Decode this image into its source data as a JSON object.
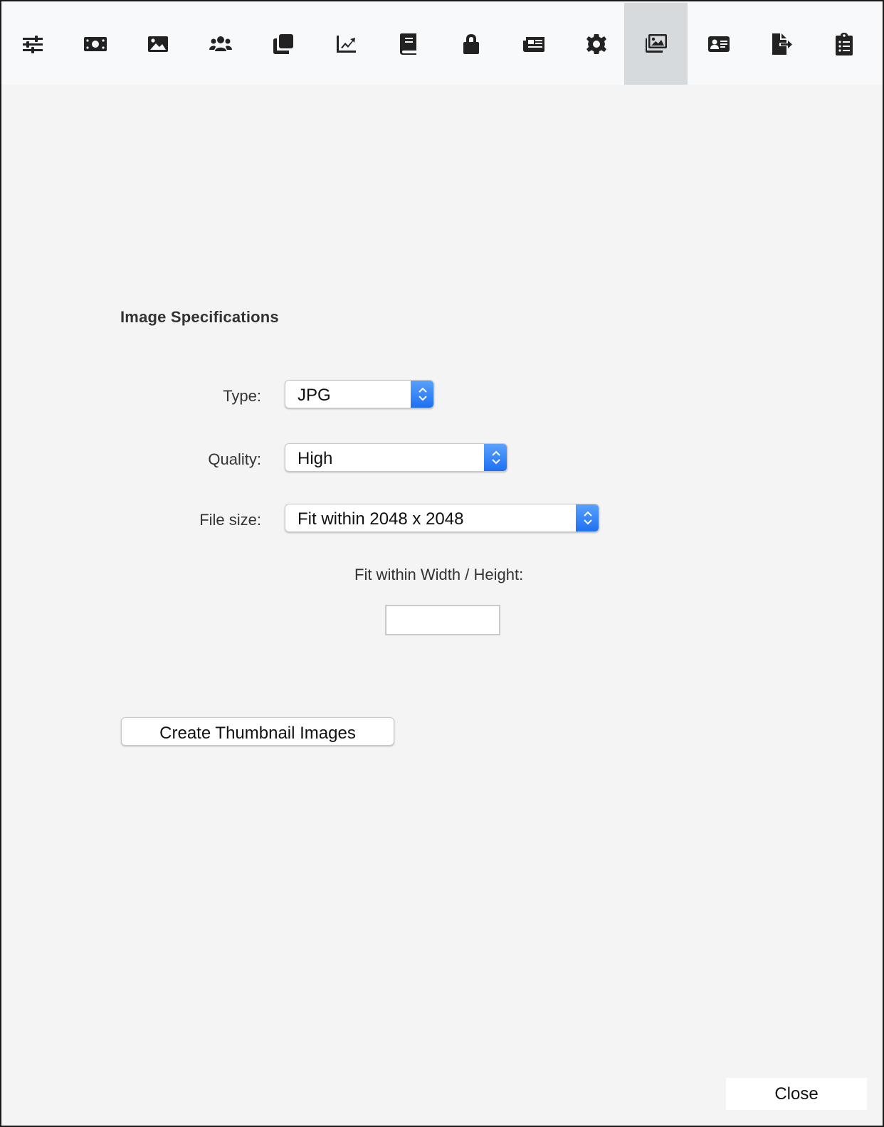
{
  "toolbar": {
    "tabs": [
      {
        "icon": "sliders-icon"
      },
      {
        "icon": "money-icon"
      },
      {
        "icon": "image-icon"
      },
      {
        "icon": "users-icon"
      },
      {
        "icon": "clone-icon"
      },
      {
        "icon": "chart-line-icon"
      },
      {
        "icon": "book-icon"
      },
      {
        "icon": "lock-icon"
      },
      {
        "icon": "newspaper-icon"
      },
      {
        "icon": "gear-icon"
      },
      {
        "icon": "images-icon",
        "active": true
      },
      {
        "icon": "id-card-icon"
      },
      {
        "icon": "file-export-icon"
      },
      {
        "icon": "clipboard-list-icon"
      }
    ],
    "active_bg": "#d7dadd"
  },
  "main": {
    "section_title": "Image Specifications",
    "type": {
      "label": "Type:",
      "value": "JPG"
    },
    "quality": {
      "label": "Quality:",
      "value": "High"
    },
    "file_size": {
      "label": "File size:",
      "value": "Fit within 2048 x 2048"
    },
    "fit_label": "Fit within Width / Height:",
    "fit_value": "",
    "create_button": "Create Thumbnail Images"
  },
  "footer": {
    "close_label": "Close"
  },
  "colors": {
    "accent": "#1c6ff1",
    "background": "#f4f4f4",
    "toolbar_bg": "#f8f9fa"
  }
}
